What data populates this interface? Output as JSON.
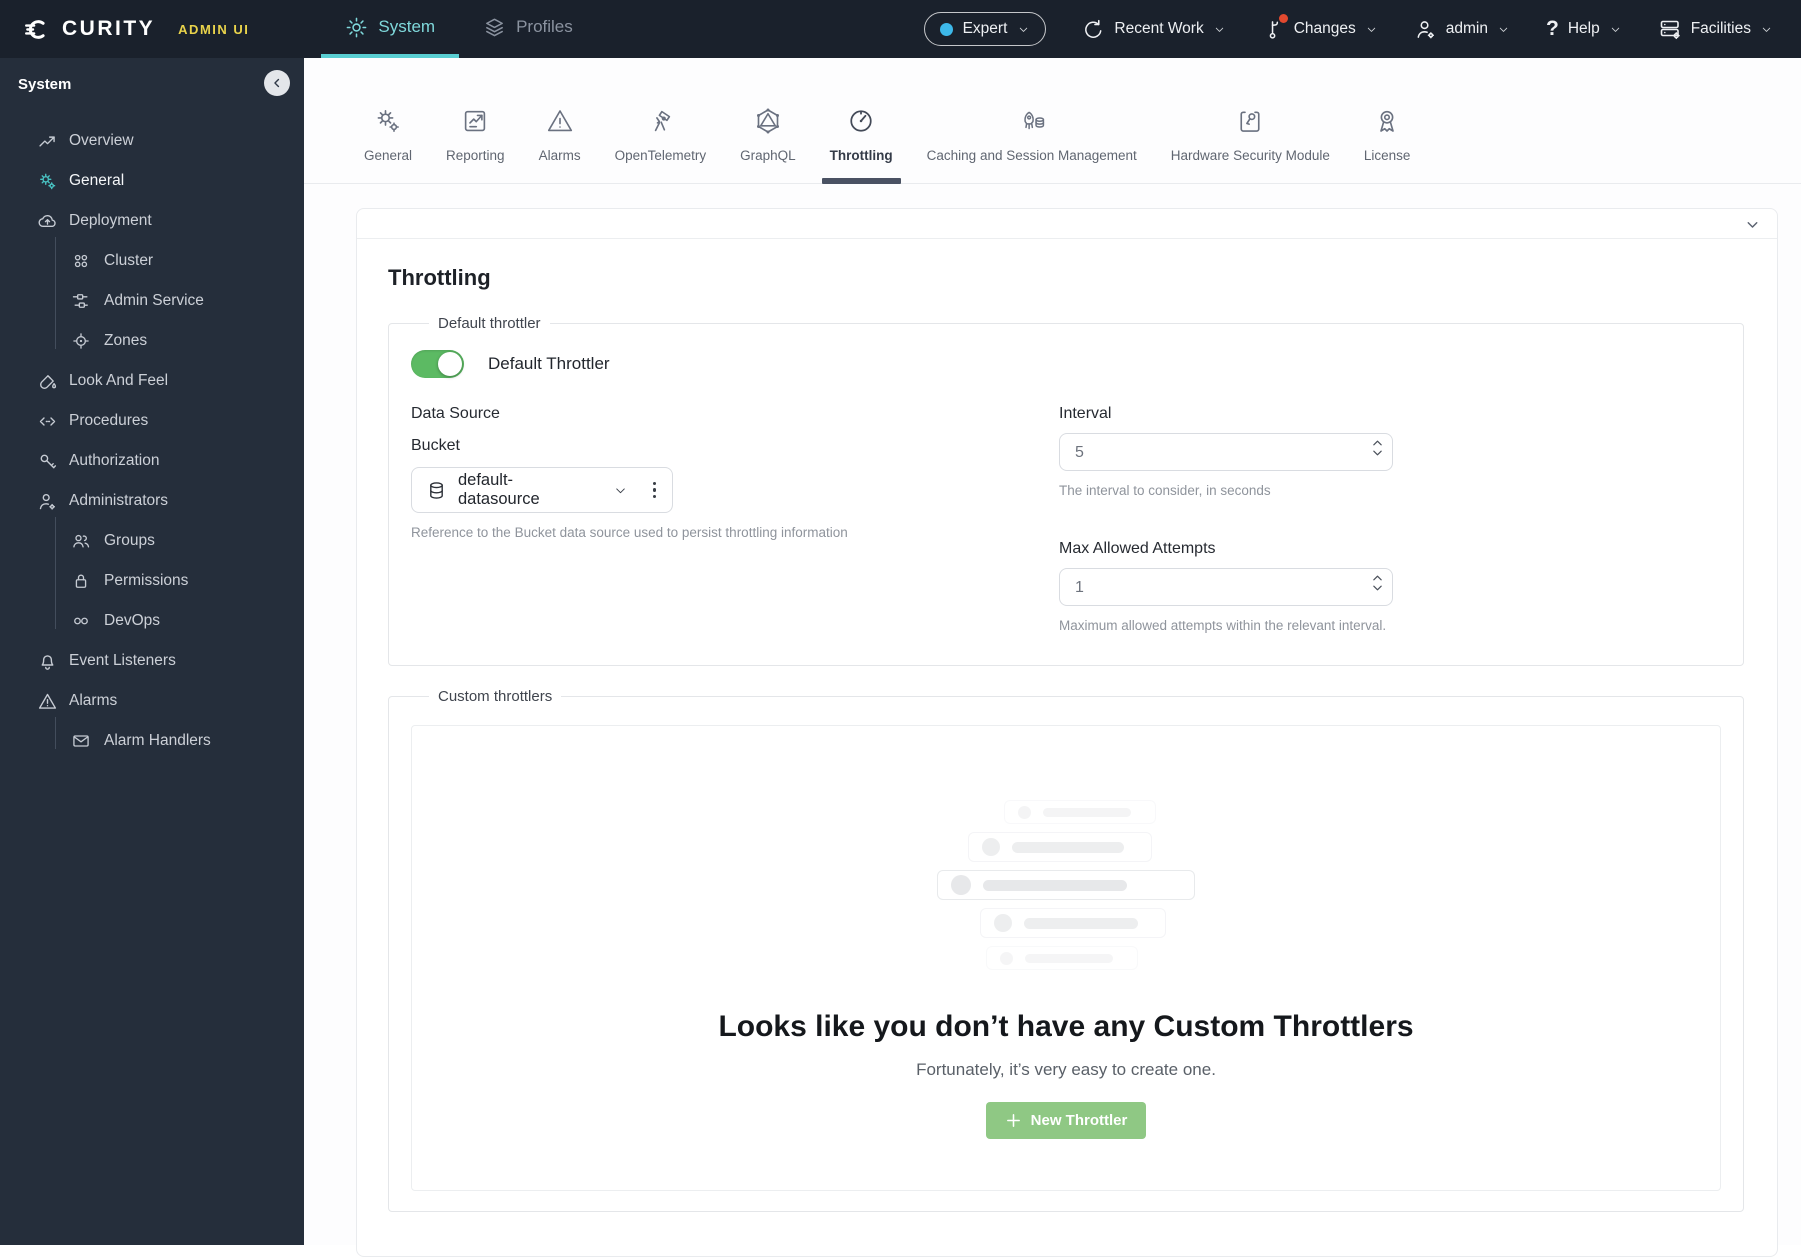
{
  "topbar": {
    "logo_text": "CURITY",
    "logo_badge": "ADMIN UI",
    "tabs": [
      {
        "label": "System",
        "active": true
      },
      {
        "label": "Profiles",
        "active": false
      }
    ],
    "mode": {
      "label": "Expert"
    },
    "menus": {
      "recent_work": "Recent Work",
      "changes": "Changes",
      "user": "admin",
      "help": "Help",
      "help_glyph": "?",
      "facilities": "Facilities"
    }
  },
  "sidebar": {
    "title": "System",
    "items": [
      {
        "label": "Overview",
        "icon": "trend-icon"
      },
      {
        "label": "General",
        "icon": "gears-icon",
        "active": true
      },
      {
        "label": "Deployment",
        "icon": "cloud-upload-icon",
        "children": [
          {
            "label": "Cluster",
            "icon": "cluster-icon"
          },
          {
            "label": "Admin Service",
            "icon": "hierarchy-icon"
          },
          {
            "label": "Zones",
            "icon": "target-icon"
          }
        ]
      },
      {
        "label": "Look And Feel",
        "icon": "paint-bucket-icon"
      },
      {
        "label": "Procedures",
        "icon": "code-icon"
      },
      {
        "label": "Authorization",
        "icon": "key-icon"
      },
      {
        "label": "Administrators",
        "icon": "user-gear-icon",
        "children": [
          {
            "label": "Groups",
            "icon": "users-icon"
          },
          {
            "label": "Permissions",
            "icon": "lock-icon"
          },
          {
            "label": "DevOps",
            "icon": "infinity-icon"
          }
        ]
      },
      {
        "label": "Event Listeners",
        "icon": "bell-icon"
      },
      {
        "label": "Alarms",
        "icon": "warning-icon",
        "children": [
          {
            "label": "Alarm Handlers",
            "icon": "mail-icon"
          }
        ]
      }
    ]
  },
  "content": {
    "tabs": [
      {
        "label": "General"
      },
      {
        "label": "Reporting"
      },
      {
        "label": "Alarms"
      },
      {
        "label": "OpenTelemetry"
      },
      {
        "label": "GraphQL"
      },
      {
        "label": "Throttling",
        "active": true
      },
      {
        "label": "Caching and Session Management"
      },
      {
        "label": "Hardware Security Module"
      },
      {
        "label": "License"
      }
    ],
    "heading": "Throttling",
    "default_throttler": {
      "legend": "Default throttler",
      "toggle_label": "Default Throttler",
      "toggle_state": "on",
      "data_source_label": "Data Source",
      "bucket_label": "Bucket",
      "bucket_value": "default-datasource",
      "bucket_helper": "Reference to the Bucket data source used to persist throttling information",
      "interval_label": "Interval",
      "interval_value": "5",
      "interval_helper": "The interval to consider, in seconds",
      "max_attempts_label": "Max Allowed Attempts",
      "max_attempts_value": "1",
      "max_attempts_helper": "Maximum allowed attempts within the relevant interval."
    },
    "custom_throttlers": {
      "legend": "Custom throttlers",
      "empty_title": "Looks like you don’t have any Custom Throttlers",
      "empty_subtitle": "Fortunately, it’s very easy to create one.",
      "new_button_label": "New Throttler"
    }
  },
  "colors": {
    "topbar_bg": "#1a212c",
    "sidebar_bg": "#252e3b",
    "accent_teal": "#59ced2",
    "badge_yellow": "#e9d34b",
    "toggle_green": "#5cba63",
    "button_green": "#8fc884",
    "mode_dot_blue": "#3db8e9",
    "notification_red": "#e2492f",
    "active_tab_underline": "#4a5263"
  }
}
